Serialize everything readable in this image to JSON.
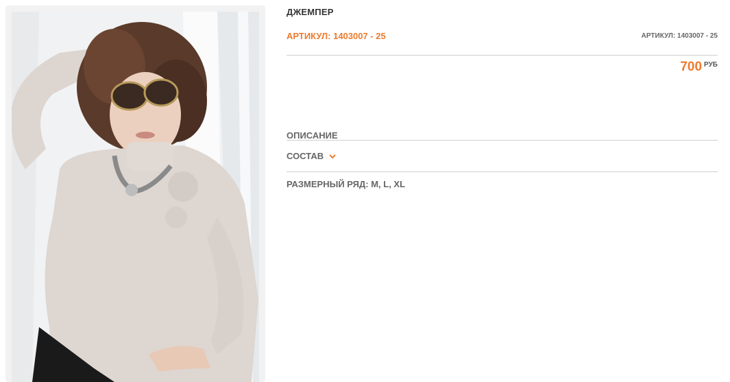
{
  "product": {
    "title": "ДЖЕМПЕР",
    "sku_main": "АРТИКУЛ: 1403007 - 25",
    "sku_small": "АРТИКУЛ: 1403007 - 25",
    "price_value": "700",
    "price_currency": "РУБ"
  },
  "sections": {
    "description": "ОПИСАНИЕ",
    "composition": "СОСТАВ",
    "sizes": "РАЗМЕРНЫЙ РЯД: M, L, XL"
  },
  "colors": {
    "accent": "#ee7a2c",
    "text": "#666666",
    "divider": "#cfcfcf"
  },
  "icons": {
    "composition_toggle": "chevron-down-icon"
  }
}
